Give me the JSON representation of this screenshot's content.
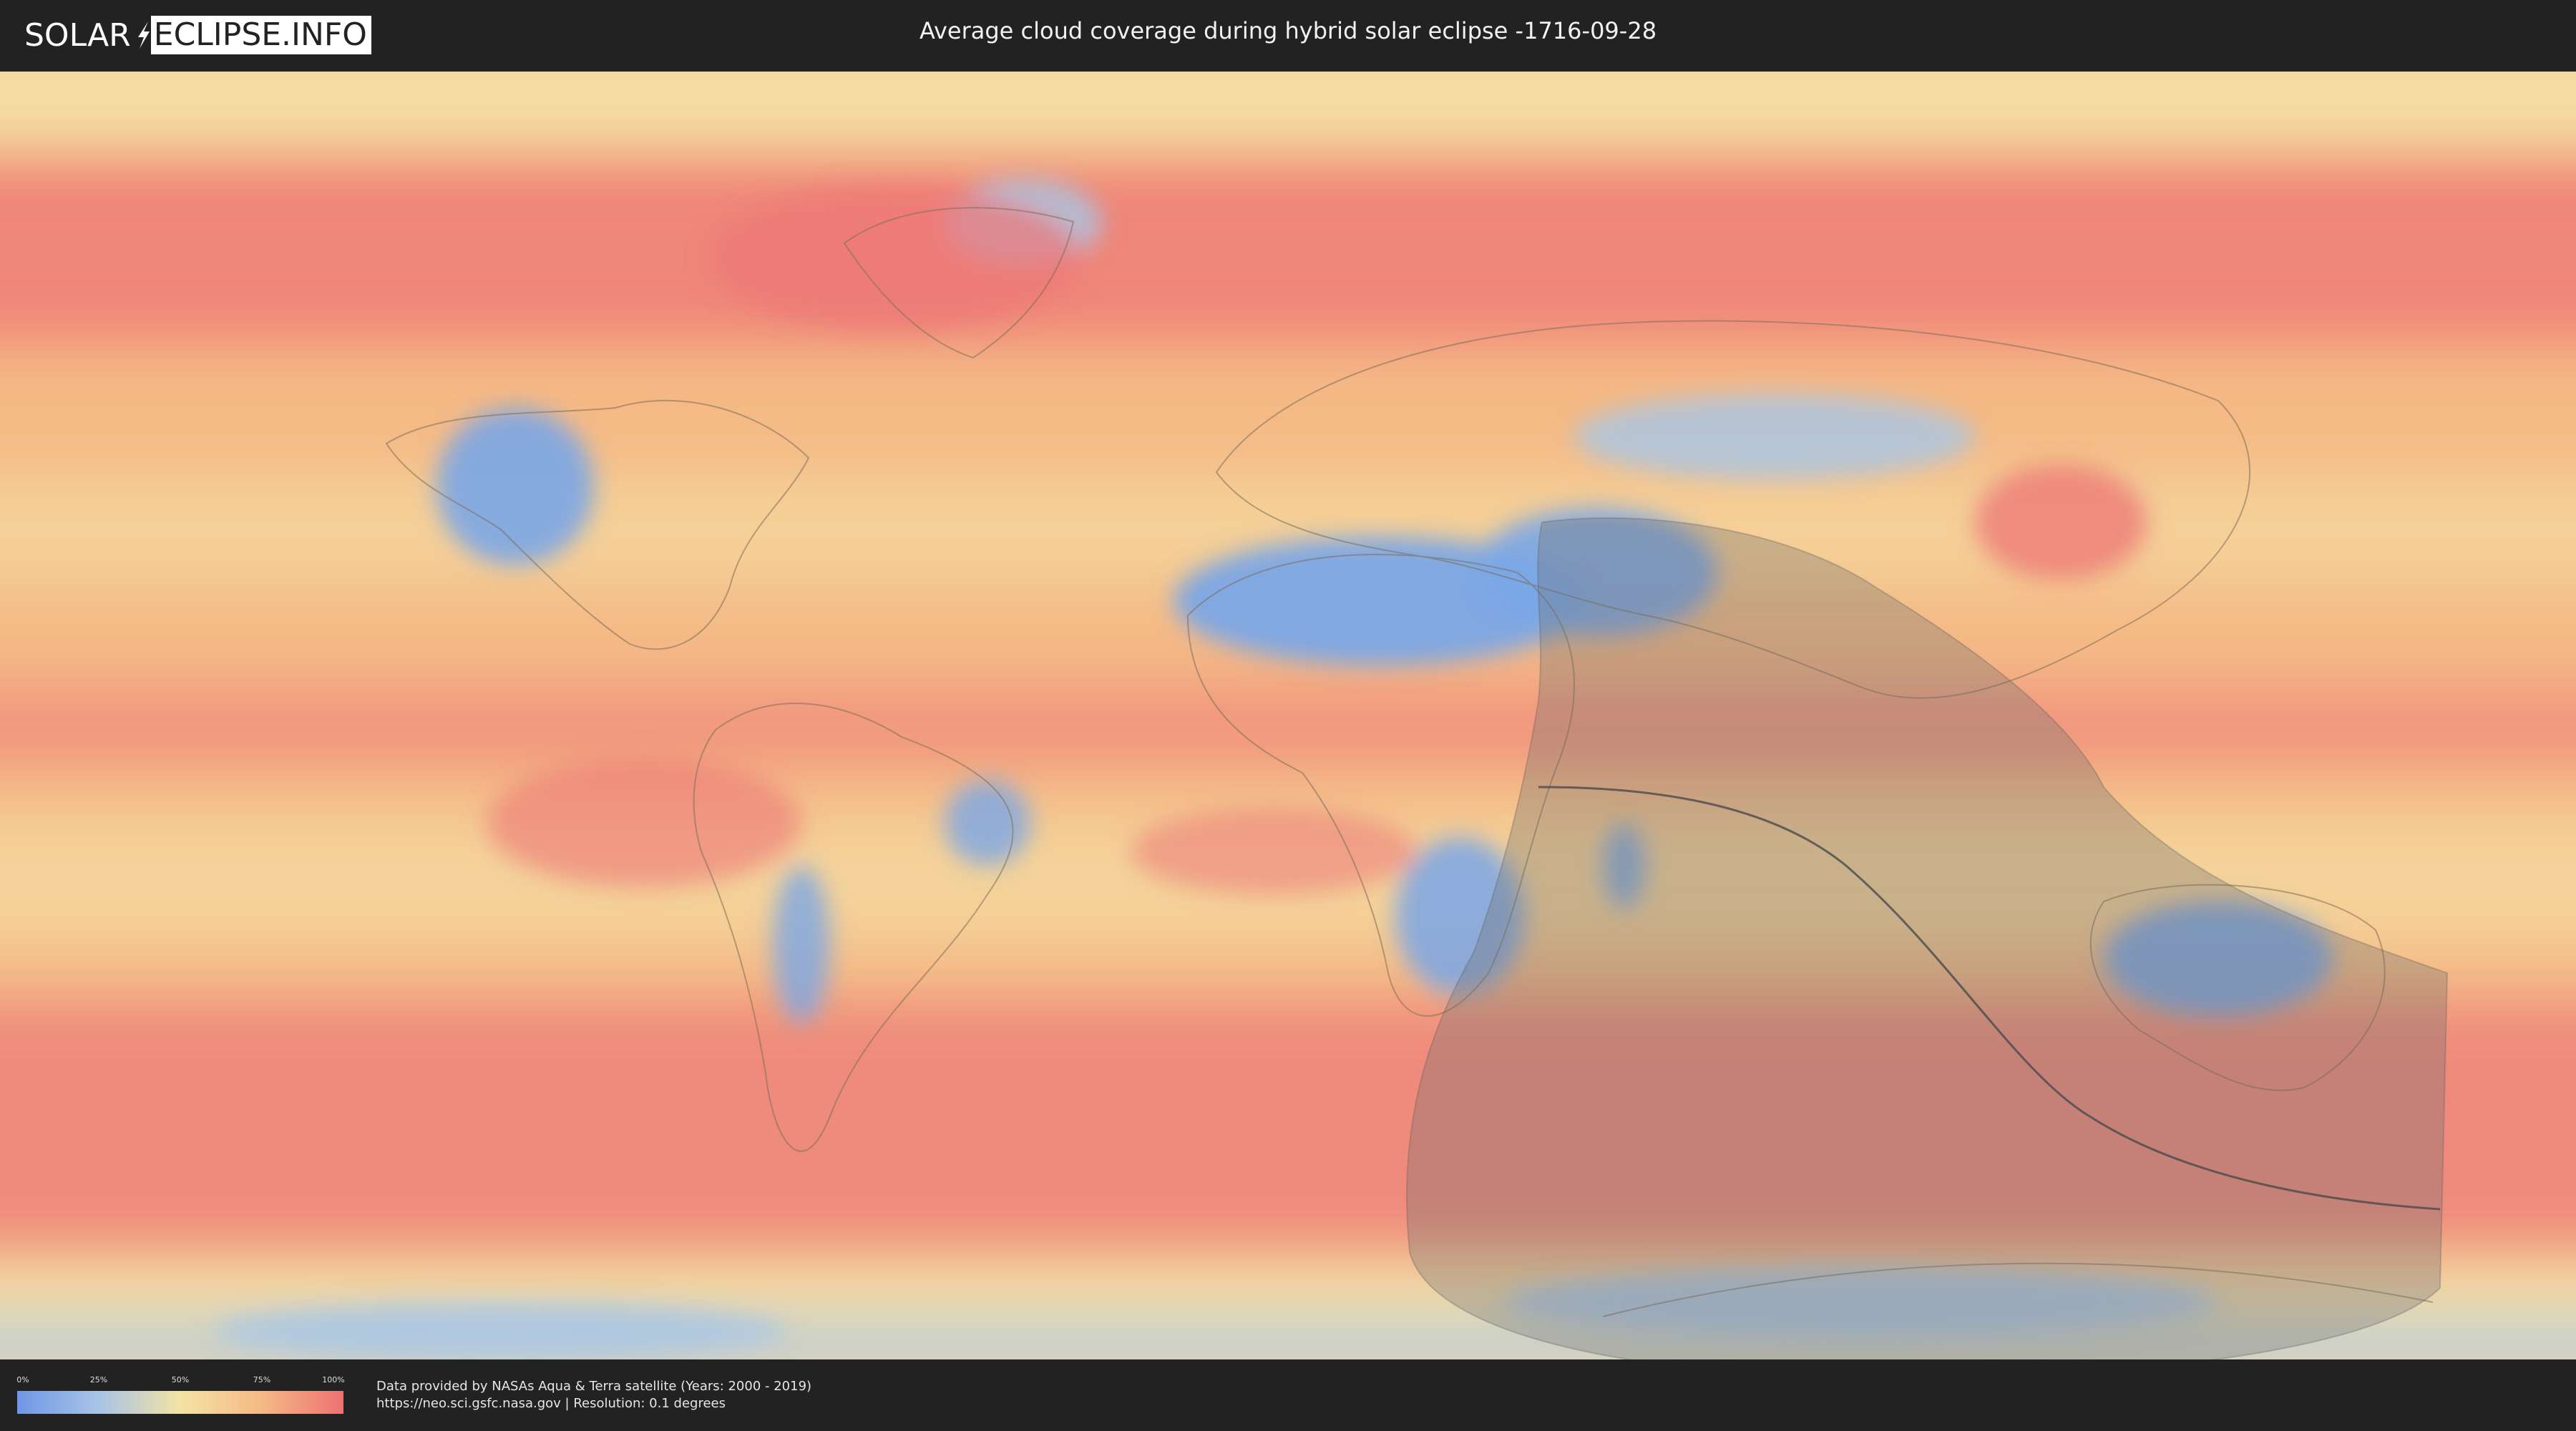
{
  "header": {
    "logo_left": "SOLAR",
    "logo_right": "ECLIPSE.INFO",
    "title": "Average cloud coverage during hybrid solar eclipse -1716-09-28"
  },
  "map": {
    "colors": {
      "clear": "#7aa6e6",
      "low": "#a8c6e6",
      "mid": "#f4e2a6",
      "high": "#f5ba86",
      "full": "#ec7676",
      "shadow": "#6d6d6d",
      "path": "#4a4a4a"
    }
  },
  "legend": {
    "ticks": [
      "0%",
      "25%",
      "50%",
      "75%",
      "100%"
    ]
  },
  "credits": {
    "line1": "Data provided by NASAs Aqua & Terra satellite (Years: 2000 - 2019)",
    "line2": "https://neo.sci.gsfc.nasa.gov | Resolution: 0.1 degrees"
  }
}
